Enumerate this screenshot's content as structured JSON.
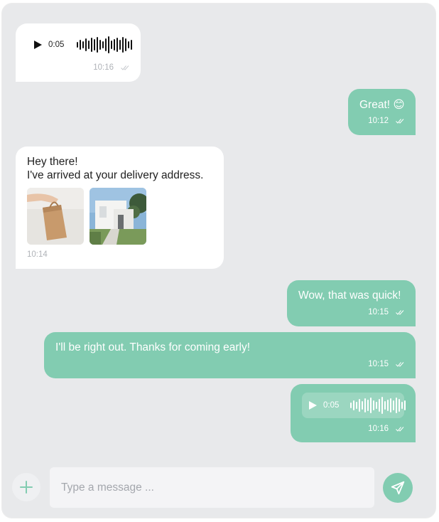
{
  "messages": [
    {
      "direction": "incoming",
      "type": "voice",
      "duration": "0:05",
      "time": "10:16"
    },
    {
      "direction": "outgoing",
      "type": "text",
      "text": "Great! 😊",
      "time": "10:12"
    },
    {
      "direction": "incoming",
      "type": "text+images",
      "line1": "Hey there!",
      "line2": "I've arrived at your delivery address.",
      "images": [
        "paper-bag-photo",
        "white-house-photo"
      ],
      "time": "10:14"
    },
    {
      "direction": "outgoing",
      "type": "text",
      "text": "Wow, that was quick!",
      "time": "10:15"
    },
    {
      "direction": "outgoing",
      "type": "text",
      "text": "I'll be right out. Thanks for coming early!",
      "time": "10:15"
    },
    {
      "direction": "outgoing",
      "type": "voice",
      "duration": "0:05",
      "time": "10:16"
    }
  ],
  "composer": {
    "placeholder": "Type a message ...",
    "attach_icon": "plus-icon",
    "send_icon": "send-icon"
  },
  "colors": {
    "background": "#e8e9eb",
    "incoming_bubble": "#ffffff",
    "outgoing_bubble": "#82ccb1",
    "input_background": "#f4f4f6"
  }
}
